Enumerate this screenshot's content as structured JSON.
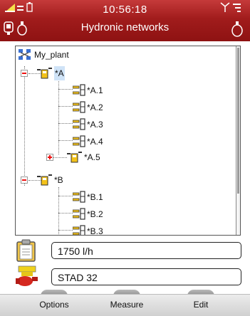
{
  "status": {
    "time": "10:56:18"
  },
  "screen": {
    "title": "Hydronic networks"
  },
  "tree": {
    "root": "My_plant",
    "nodes": [
      {
        "label": "*A",
        "selected": true,
        "expanded": true
      },
      {
        "label": "*A.1"
      },
      {
        "label": "*A.2"
      },
      {
        "label": "*A.3"
      },
      {
        "label": "*A.4"
      },
      {
        "label": "*A.5",
        "expanded": false
      },
      {
        "label": "*B",
        "expanded": true
      },
      {
        "label": "*B.1"
      },
      {
        "label": "*B.2"
      },
      {
        "label": "*B.3"
      }
    ]
  },
  "fields": {
    "flow": "1750 l/h",
    "valve": "STAD 32"
  },
  "softkeys": {
    "left": "Options",
    "middle": "Measure",
    "right": "Edit"
  },
  "colors": {
    "header": "#a11c1c",
    "selection": "#cfe3f7",
    "expander_sign": "#e11111"
  }
}
